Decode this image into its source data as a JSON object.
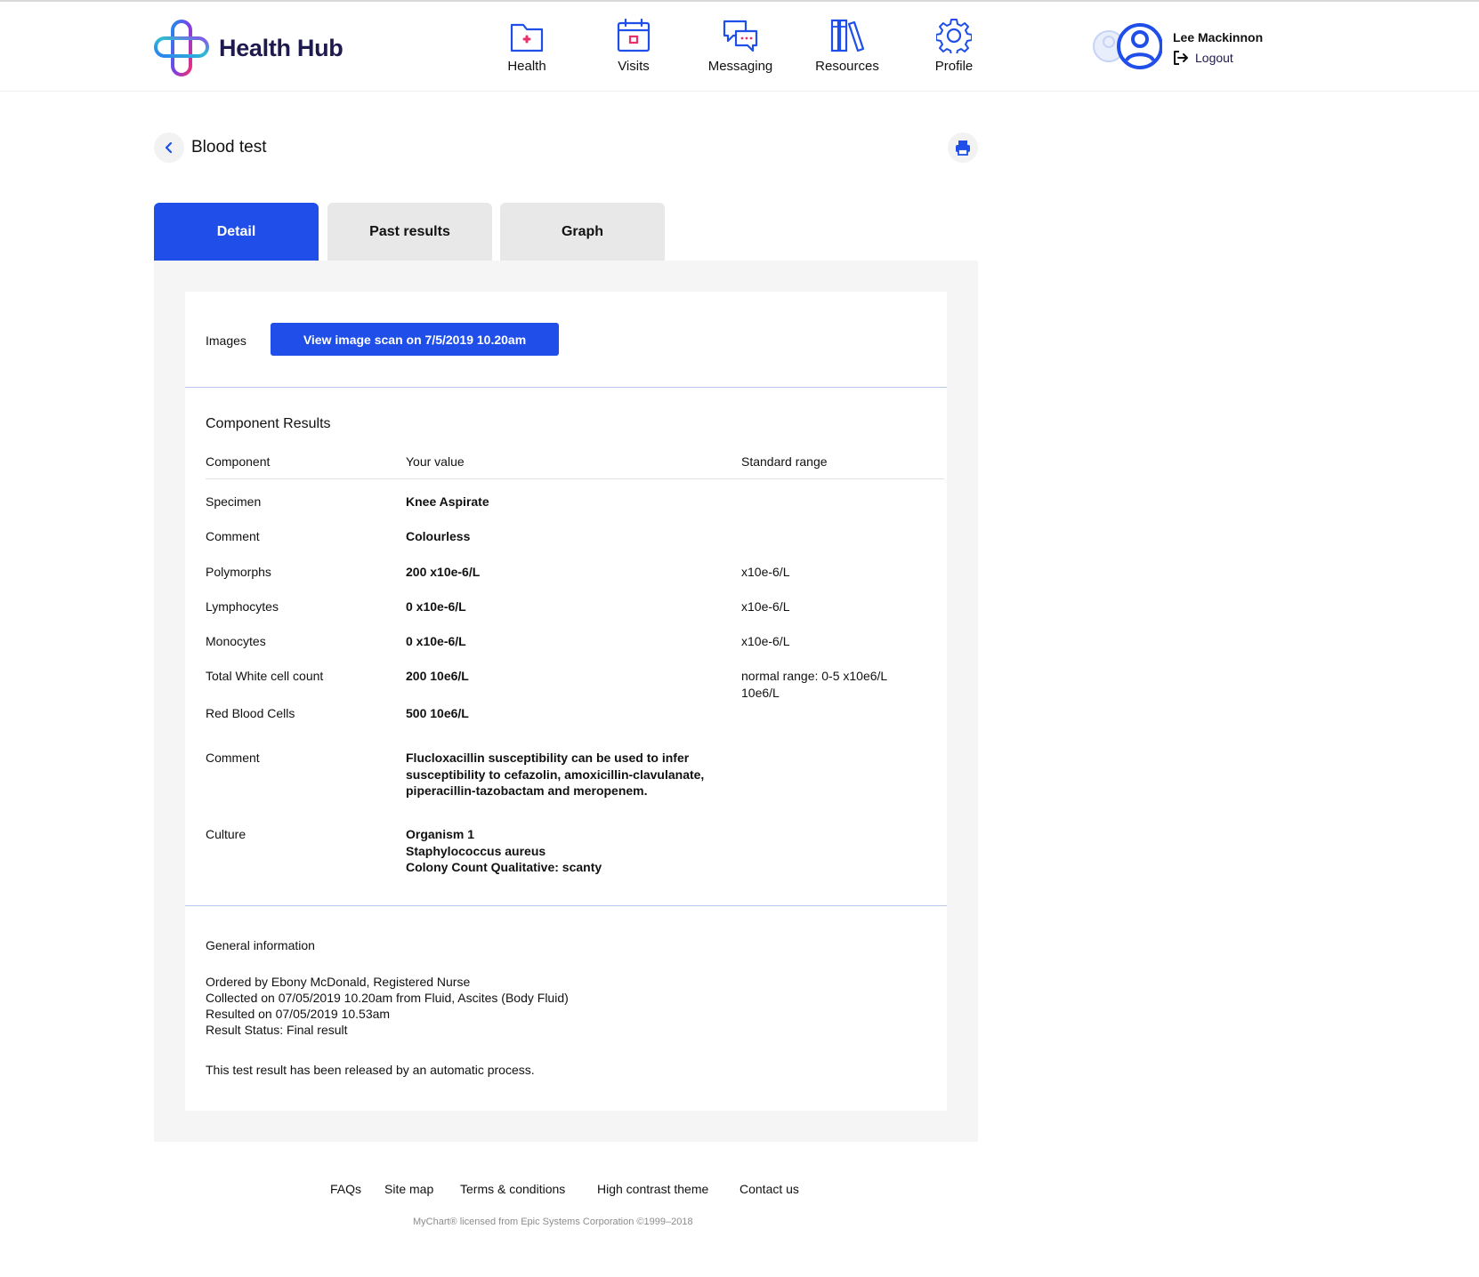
{
  "app": {
    "name": "Health Hub"
  },
  "nav": {
    "items": [
      {
        "label": "Health",
        "icon": "health-folder-icon"
      },
      {
        "label": "Visits",
        "icon": "calendar-icon"
      },
      {
        "label": "Messaging",
        "icon": "chat-bubbles-icon"
      },
      {
        "label": "Resources",
        "icon": "books-icon"
      },
      {
        "label": "Profile",
        "icon": "gear-icon"
      }
    ]
  },
  "user": {
    "name": "Lee Mackinnon",
    "logout_label": "Logout"
  },
  "page": {
    "title": "Blood test"
  },
  "tabs": [
    {
      "label": "Detail",
      "active": true
    },
    {
      "label": "Past results",
      "active": false
    },
    {
      "label": "Graph",
      "active": false
    }
  ],
  "images": {
    "label": "Images",
    "button_label": "View image scan on 7/5/2019 10.20am"
  },
  "component_results": {
    "title": "Component Results",
    "headers": {
      "component": "Component",
      "value": "Your value",
      "range": "Standard range"
    },
    "rows": [
      {
        "component": "Specimen",
        "value": "Knee Aspirate",
        "range": ""
      },
      {
        "component": "Comment",
        "value": "Colourless",
        "range": ""
      },
      {
        "component": "Polymorphs",
        "value": "200 x10e-6/L",
        "range": "x10e-6/L"
      },
      {
        "component": "Lymphocytes",
        "value": "0 x10e-6/L",
        "range": "x10e-6/L"
      },
      {
        "component": "Monocytes",
        "value": "0 x10e-6/L",
        "range": "x10e-6/L"
      },
      {
        "component": "Total White cell count",
        "value": "200 10e6/L",
        "range": "normal range: 0-5 x10e6/L 10e6/L"
      },
      {
        "component": "Red Blood Cells",
        "value": "500 10e6/L",
        "range": ""
      },
      {
        "component": "Comment",
        "value": "Flucloxacillin susceptibility can be used to infer susceptibility to cefazolin, amoxicillin-clavulanate, piperacillin-tazobactam and meropenem.",
        "range": ""
      },
      {
        "component": "Culture",
        "value": "Organism 1\nStaphylococcus aureus\nColony Count Qualitative: scanty",
        "range": ""
      }
    ]
  },
  "general_information": {
    "title": "General information",
    "lines": [
      "Ordered by Ebony McDonald, Registered Nurse",
      "Collected on 07/05/2019 10.20am from Fluid, Ascites (Body Fluid)",
      "Resulted on 07/05/2019 10.53am",
      "Result Status: Final result"
    ],
    "note": "This test result has been released by an automatic process."
  },
  "footer": {
    "links": [
      "FAQs",
      "Site map",
      "Terms & conditions",
      "High contrast theme",
      "Contact us"
    ],
    "copyright": "MyChart® licensed from Epic Systems Corporation ©1999–2018"
  },
  "colors": {
    "accent": "#1f4fe8",
    "brand_dark": "#1f1a4d",
    "tab_inactive": "#e8e8e8",
    "panel_bg": "#f5f5f5",
    "health_icon_accent": "#e8306a"
  }
}
